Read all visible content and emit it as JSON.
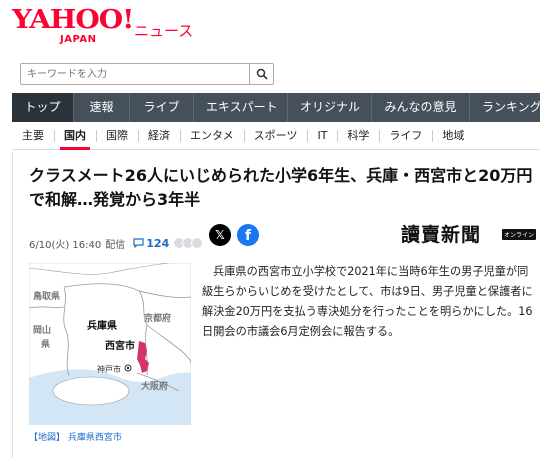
{
  "logo": {
    "word": "YAHOO!",
    "sub": "JAPAN",
    "section": "ニュース"
  },
  "search": {
    "placeholder": "キーワードを入力"
  },
  "nav": [
    "トップ",
    "速報",
    "ライブ",
    "エキスパート",
    "オリジナル",
    "みんなの意見",
    "ランキング"
  ],
  "subnav": [
    "主要",
    "国内",
    "国際",
    "経済",
    "エンタメ",
    "スポーツ",
    "IT",
    "科学",
    "ライフ",
    "地域"
  ],
  "article": {
    "title": "クラスメート26人にいじめられた小学6年生、兵庫・西宮市と20万円で和解…発覚から3年半",
    "date": "6/10(火) 16:40",
    "category": "配信",
    "comments": "124",
    "source": "讀賣新聞",
    "source_badge": "オンライン",
    "body": "兵庫県の西宮市立小学校で2021年に当時6年生の男子児童が同級生らからいじめを受けたとして、市は9日、男子児童と保護者に解決金20万円を支払う専決処分を行ったことを明らかにした。16日開会の市議会6月定例会に報告する。",
    "map_caption": "【地図】 兵庫県西宮市"
  },
  "map": {
    "labels": {
      "tottori": "鳥取県",
      "kyoto": "京都府",
      "okayama": "岡山\n県",
      "hyogo": "兵庫県",
      "nishinomiya": "西宮市",
      "kobe": "神戸市",
      "osaka": "大阪府"
    },
    "colors": {
      "land": "#ffffff",
      "sea": "#d3e6f5",
      "border": "#999999",
      "highlight": "#d6336c"
    }
  },
  "colors": {
    "brand": "#ff0033",
    "nav_bg": "#45505a",
    "link": "#1a6fc4"
  }
}
